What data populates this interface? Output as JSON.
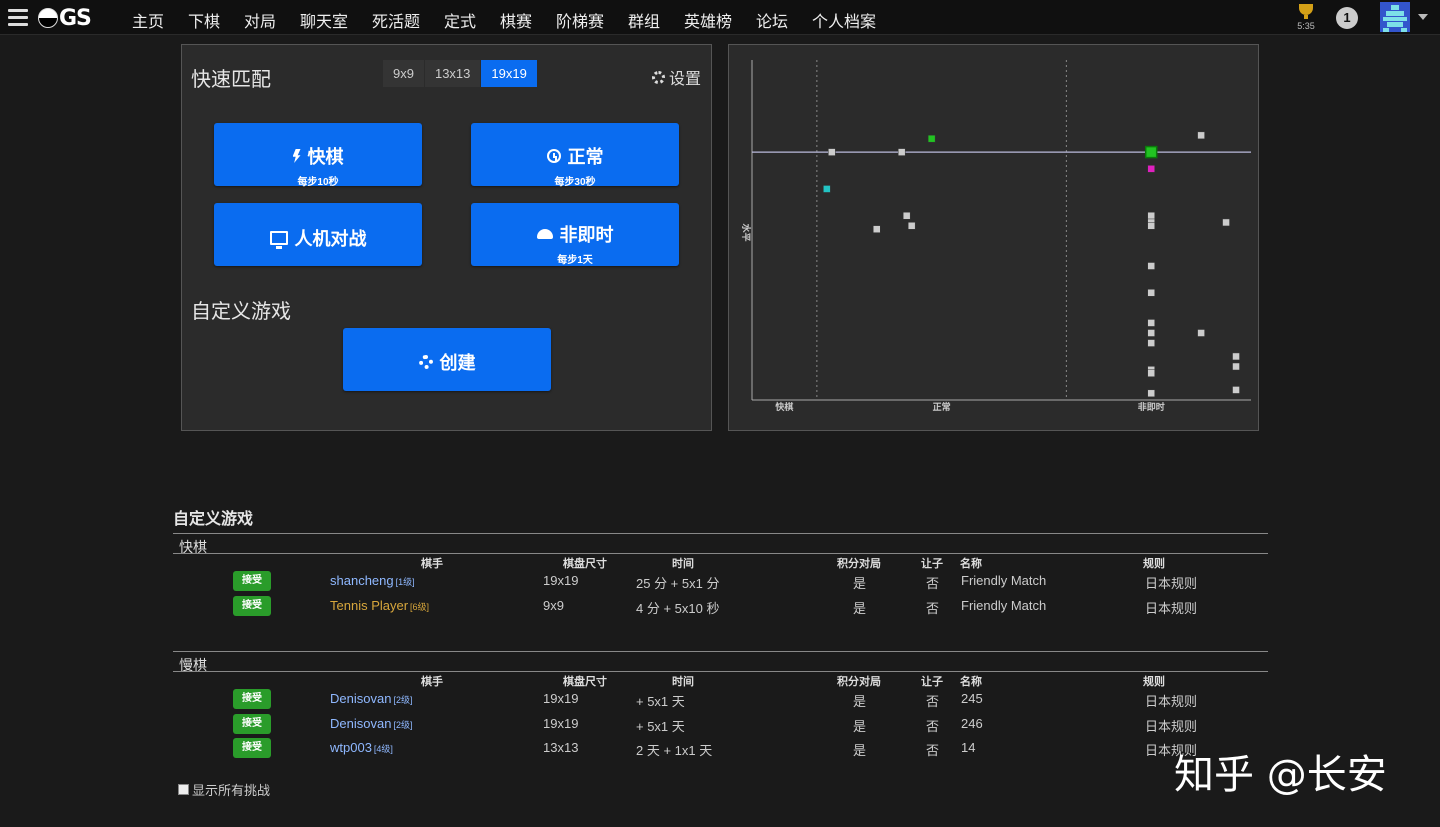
{
  "nav": {
    "logo_text": "GS",
    "links": [
      "主页",
      "下棋",
      "对局",
      "聊天室",
      "死活题",
      "定式",
      "棋赛",
      "阶梯赛",
      "群组",
      "英雄榜",
      "论坛",
      "个人档案"
    ],
    "trophy_time": "5:35",
    "notification_count": "1"
  },
  "quick_match": {
    "title": "快速匹配",
    "board_sizes": [
      "9x9",
      "13x13",
      "19x19"
    ],
    "selected_size": "19x19",
    "settings_label": "设置",
    "blitz": {
      "label": "快棋",
      "sub": "每步10秒"
    },
    "live": {
      "label": "正常",
      "sub": "每步30秒"
    },
    "computer": {
      "label": "人机对战"
    },
    "correspondence": {
      "label": "非即时",
      "sub": "每步1天"
    },
    "custom_title": "自定义游戏",
    "create_label": "创建"
  },
  "chart_data": {
    "type": "scatter",
    "xlabel": "",
    "ylabel": "水平",
    "x_tick_labels": [
      "快棋",
      "正常",
      "非即时"
    ],
    "grid": "vertical dashed separators between time categories, horizontal reference line at own rank",
    "colors": {
      "other": "#cccccc",
      "own": "#22c322",
      "highlight_cyan": "#22c3c3",
      "highlight_magenta": "#e020c0",
      "reference_line": "#bbbbdd"
    },
    "points_note": "Game challenges plotted by speed (x) and rank (y); values estimated from pixel positions within the plot area, normalized 0-1 on both axes.",
    "series": [
      {
        "name": "challenges",
        "color": "#cccccc",
        "points": [
          [
            0.16,
            0.74
          ],
          [
            0.3,
            0.74
          ],
          [
            0.32,
            0.52
          ],
          [
            0.31,
            0.55
          ],
          [
            0.25,
            0.51
          ],
          [
            0.9,
            0.79
          ],
          [
            0.8,
            0.55
          ],
          [
            0.8,
            0.53
          ],
          [
            0.8,
            0.52
          ],
          [
            0.8,
            0.4
          ],
          [
            0.8,
            0.32
          ],
          [
            0.8,
            0.23
          ],
          [
            0.8,
            0.2
          ],
          [
            0.8,
            0.17
          ],
          [
            0.8,
            0.09
          ],
          [
            0.8,
            0.08
          ],
          [
            0.8,
            0.02
          ],
          [
            0.9,
            0.2
          ],
          [
            0.95,
            0.53
          ],
          [
            0.97,
            0.13
          ],
          [
            0.97,
            0.1
          ],
          [
            0.97,
            0.03
          ]
        ]
      },
      {
        "name": "challenges-green",
        "color": "#22c322",
        "points": [
          [
            0.36,
            0.78
          ]
        ]
      },
      {
        "name": "challenges-cyan",
        "color": "#22c3c3",
        "points": [
          [
            0.15,
            0.63
          ]
        ]
      },
      {
        "name": "challenges-magenta",
        "color": "#e020c0",
        "points": [
          [
            0.8,
            0.69
          ]
        ]
      },
      {
        "name": "own",
        "color": "#22c322",
        "points": [
          [
            0.8,
            0.74
          ]
        ]
      }
    ],
    "reference_y": 0.74,
    "xlim": [
      0,
      1
    ],
    "ylim": [
      0,
      1
    ]
  },
  "games": {
    "section_title": "自定义游戏",
    "columns": {
      "player": "棋手",
      "size": "棋盘尺寸",
      "time": "时间",
      "ranked": "积分对局",
      "handicap": "让子",
      "name": "名称",
      "rules": "规则"
    },
    "accept_label": "接受",
    "blitz_group": {
      "title": "快棋",
      "rows": [
        {
          "player": "shancheng",
          "rank": "[1级]",
          "size": "19x19",
          "time": "25 分 + 5x1 分",
          "ranked": "是",
          "handicap": "否",
          "name": "Friendly Match",
          "rules": "日本规则",
          "gold": false
        },
        {
          "player": "Tennis Player",
          "rank": "[6级]",
          "size": "9x9",
          "time": "4 分 + 5x10 秒",
          "ranked": "是",
          "handicap": "否",
          "name": "Friendly Match",
          "rules": "日本规则",
          "gold": true
        }
      ]
    },
    "slow_group": {
      "title": "慢棋",
      "rows": [
        {
          "player": "Denisovan",
          "rank": "[2级]",
          "size": "19x19",
          "time": "+ 5x1 天",
          "ranked": "是",
          "handicap": "否",
          "name": "245",
          "rules": "日本规则",
          "gold": false
        },
        {
          "player": "Denisovan",
          "rank": "[2级]",
          "size": "19x19",
          "time": "+ 5x1 天",
          "ranked": "是",
          "handicap": "否",
          "name": "246",
          "rules": "日本规则",
          "gold": false
        },
        {
          "player": "wtp003",
          "rank": "[4级]",
          "size": "13x13",
          "time": "2 天 + 1x1 天",
          "ranked": "是",
          "handicap": "否",
          "name": "14",
          "rules": "日本规则",
          "gold": false
        }
      ]
    },
    "show_all_label": "显示所有挑战"
  },
  "watermark": "知乎 @长安"
}
